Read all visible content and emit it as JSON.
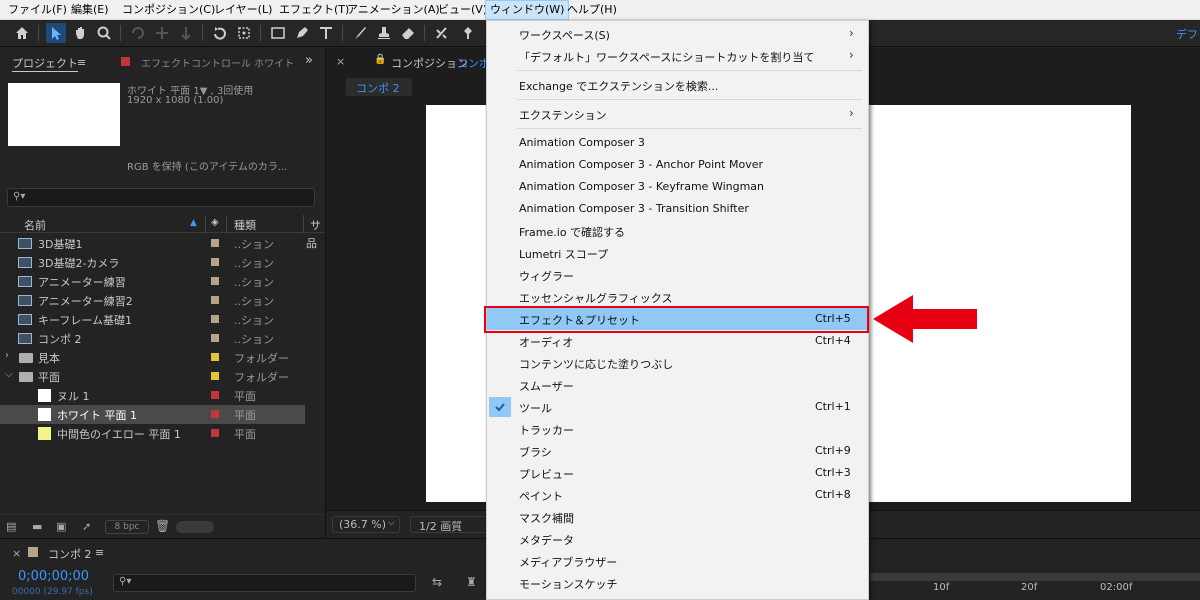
{
  "menubar": {
    "items": [
      "ファイル(F)",
      "編集(E)",
      "コンポジション(C)",
      "レイヤー(L)",
      "エフェクト(T)",
      "アニメーション(A)",
      "ビュー(V)",
      "ウィンドウ(W)",
      "ヘルプ(H)"
    ],
    "active_index": 7
  },
  "toolbar": {
    "workspace_label": "デフ",
    "icons": [
      "home-icon",
      "selection-tool-icon",
      "hand-tool-icon",
      "zoom-tool-icon",
      "rotate-tool-icon",
      "camera-tool-icon",
      "anchor-tool-icon",
      "orbit-tool-icon",
      "undo-rotate-icon",
      "behind-tool-icon",
      "rectangle-tool-icon",
      "pen-tool-icon",
      "type-tool-icon",
      "brush-tool-icon",
      "stamp-tool-icon",
      "eraser-tool-icon",
      "roto-brush-icon",
      "puppet-pin-icon"
    ]
  },
  "project": {
    "tab_label": "プロジェクト",
    "effects_tab_label": "エフェクトコントロール ホワイト",
    "selected_info": {
      "name": "ホワイト 平面 1▼ , 3回使用",
      "size": "1920 x 1080 (1.00)",
      "color": "RGB を保持 (このアイテムのカラ..."
    },
    "search_placeholder": "",
    "columns": {
      "name": "名前",
      "type": "種類",
      "extra": "サ"
    },
    "items": [
      {
        "name": "3D基礎1",
        "type": "..ション",
        "kind": "comp",
        "swatch": "#b5a38a",
        "indent": 0
      },
      {
        "name": "3D基礎2-カメラ",
        "type": "..ション",
        "kind": "comp",
        "swatch": "#b5a38a",
        "indent": 0
      },
      {
        "name": "アニメーター練習",
        "type": "..ション",
        "kind": "comp",
        "swatch": "#b5a38a",
        "indent": 0
      },
      {
        "name": "アニメーター練習2",
        "type": "..ション",
        "kind": "comp",
        "swatch": "#b5a38a",
        "indent": 0
      },
      {
        "name": "キーフレーム基礎1",
        "type": "..ション",
        "kind": "comp",
        "swatch": "#b5a38a",
        "indent": 0
      },
      {
        "name": "コンポ 2",
        "type": "..ション",
        "kind": "comp",
        "swatch": "#b5a38a",
        "indent": 0
      },
      {
        "name": "見本",
        "type": "フォルダー",
        "kind": "folder",
        "swatch": "#e0c53a",
        "indent": 0,
        "expanded": false
      },
      {
        "name": "平面",
        "type": "フォルダー",
        "kind": "folder",
        "swatch": "#e0c53a",
        "indent": 0,
        "expanded": true
      },
      {
        "name": "ヌル 1",
        "type": "平面",
        "kind": "solid",
        "solid_color": "#ffffff",
        "swatch": "#c0363a",
        "indent": 1
      },
      {
        "name": "ホワイト 平面 1",
        "type": "平面",
        "kind": "solid",
        "solid_color": "#ffffff",
        "swatch": "#c0363a",
        "indent": 1,
        "selected": true
      },
      {
        "name": "中間色のイエロー 平面 1",
        "type": "平面",
        "kind": "solid",
        "solid_color": "#f4f48a",
        "swatch": "#c0363a",
        "indent": 1
      }
    ],
    "footer": {
      "bpc": "8 bpc"
    }
  },
  "viewer": {
    "tab_label": "コンポジション",
    "tab_comp_name": "コンポ",
    "comp_tab": "コンポ 2",
    "zoom": "(36.7 %)",
    "resolution": "1/2 画質"
  },
  "timeline": {
    "tab_label": "コンポ 2",
    "timecode": "0;00;00;00",
    "frames": "00000 (29.97 fps)",
    "ruler": [
      "10f",
      "20f",
      "02:00f"
    ]
  },
  "window_menu": {
    "items": [
      {
        "label": "ワークスペース(S)",
        "submenu": true
      },
      {
        "label": "「デフォルト」ワークスペースにショートカットを割り当て",
        "submenu": true
      },
      {
        "sep": true
      },
      {
        "label": "Exchange でエクステンションを検索..."
      },
      {
        "sep": true
      },
      {
        "label": "エクステンション",
        "submenu": true
      },
      {
        "sep": true
      },
      {
        "label": "Animation Composer 3"
      },
      {
        "label": "Animation Composer 3 - Anchor Point Mover"
      },
      {
        "label": "Animation Composer 3 - Keyframe Wingman"
      },
      {
        "label": "Animation Composer 3 - Transition Shifter"
      },
      {
        "label": "Frame.io で確認する"
      },
      {
        "label": "Lumetri スコープ"
      },
      {
        "label": "ウィグラー"
      },
      {
        "label": "エッセンシャルグラフィックス"
      },
      {
        "label": "エフェクト＆プリセット",
        "shortcut": "Ctrl+5",
        "highlighted": true
      },
      {
        "label": "オーディオ",
        "shortcut": "Ctrl+4"
      },
      {
        "label": "コンテンツに応じた塗りつぶし"
      },
      {
        "label": "スムーザー"
      },
      {
        "label": "ツール",
        "shortcut": "Ctrl+1",
        "checked": true
      },
      {
        "label": "トラッカー"
      },
      {
        "label": "ブラシ",
        "shortcut": "Ctrl+9"
      },
      {
        "label": "プレビュー",
        "shortcut": "Ctrl+3"
      },
      {
        "label": "ペイント",
        "shortcut": "Ctrl+8"
      },
      {
        "label": "マスク補間"
      },
      {
        "label": "メタデータ"
      },
      {
        "label": "メディアブラウザー"
      },
      {
        "label": "モーションスケッチ"
      }
    ]
  },
  "annotation": {
    "arrow_color": "#e60012",
    "box_color": "#e60012"
  }
}
